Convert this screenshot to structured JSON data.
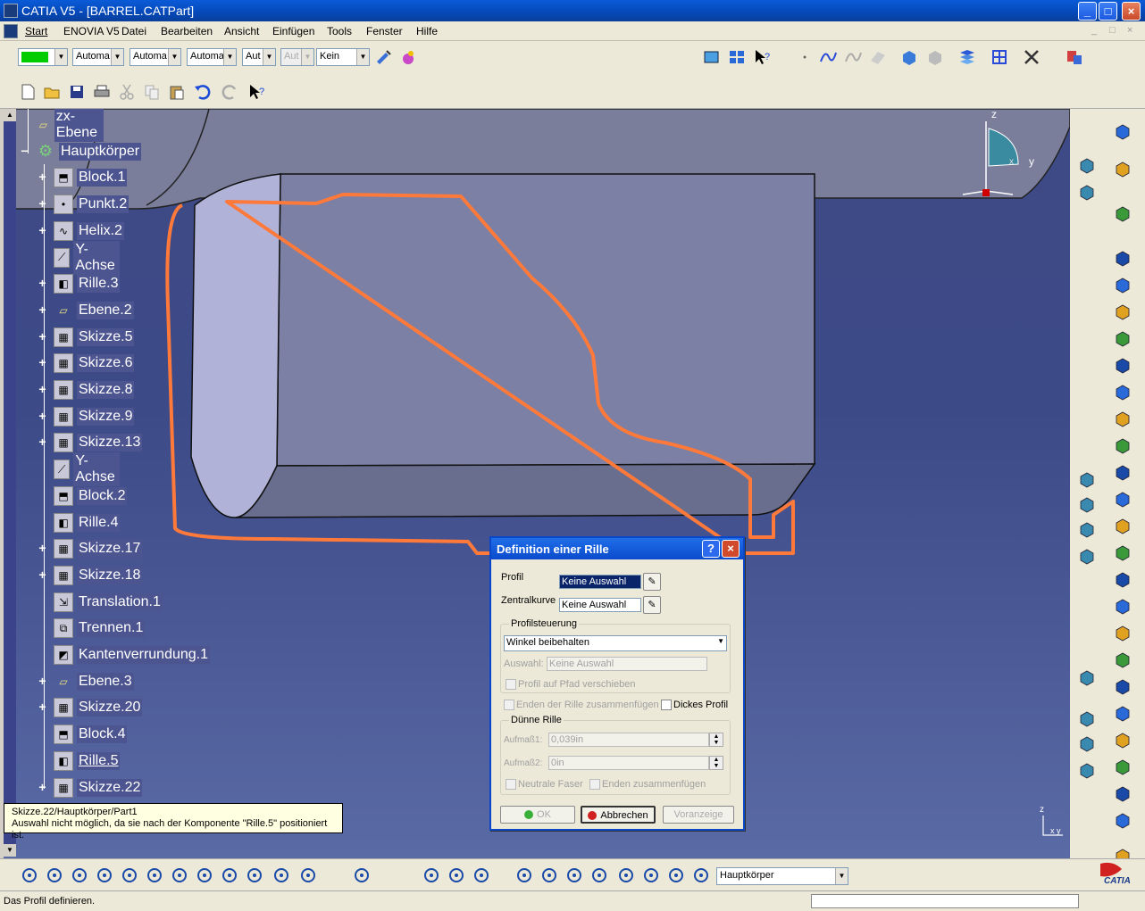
{
  "window": {
    "title": "CATIA V5 - [BARREL.CATPart]"
  },
  "menu": {
    "items": [
      "Start",
      "ENOVIA V5",
      "Datei",
      "Bearbeiten",
      "Ansicht",
      "Einfügen",
      "Tools",
      "Fenster",
      "Hilfe"
    ]
  },
  "toolbar": {
    "color_value": "",
    "combos": [
      "Automa",
      "Automa",
      "Automa",
      "Aut",
      "Aut",
      "Kein"
    ]
  },
  "tree": {
    "nodes": [
      {
        "label": "zx-Ebene",
        "icon": "plane-icon",
        "expandable": false
      },
      {
        "label": "Hauptkörper",
        "icon": "body-icon",
        "expandable": true
      },
      {
        "label": "Block.1",
        "icon": "pad-icon",
        "expandable": true
      },
      {
        "label": "Punkt.2",
        "icon": "point-icon",
        "expandable": true
      },
      {
        "label": "Helix.2",
        "icon": "helix-icon",
        "expandable": true
      },
      {
        "label": "Y-Achse",
        "icon": "axis-icon",
        "expandable": false
      },
      {
        "label": "Rille.3",
        "icon": "groove-icon",
        "expandable": true
      },
      {
        "label": "Ebene.2",
        "icon": "plane-icon",
        "expandable": true
      },
      {
        "label": "Skizze.5",
        "icon": "sketch-icon",
        "expandable": true
      },
      {
        "label": "Skizze.6",
        "icon": "sketch-icon",
        "expandable": true
      },
      {
        "label": "Skizze.8",
        "icon": "sketch-icon",
        "expandable": true
      },
      {
        "label": "Skizze.9",
        "icon": "sketch-icon",
        "expandable": true
      },
      {
        "label": "Skizze.13",
        "icon": "sketch-icon",
        "expandable": true
      },
      {
        "label": "Y-Achse",
        "icon": "axis-icon",
        "expandable": false
      },
      {
        "label": "Block.2",
        "icon": "pad-icon",
        "expandable": false
      },
      {
        "label": "Rille.4",
        "icon": "groove-icon",
        "expandable": false
      },
      {
        "label": "Skizze.17",
        "icon": "sketch-icon",
        "expandable": true
      },
      {
        "label": "Skizze.18",
        "icon": "sketch-icon",
        "expandable": true
      },
      {
        "label": "Translation.1",
        "icon": "translation-icon",
        "expandable": false
      },
      {
        "label": "Trennen.1",
        "icon": "split-icon",
        "expandable": false
      },
      {
        "label": "Kantenverrundung.1",
        "icon": "fillet-icon",
        "expandable": false
      },
      {
        "label": "Ebene.3",
        "icon": "plane-icon",
        "expandable": true
      },
      {
        "label": "Skizze.20",
        "icon": "sketch-icon",
        "expandable": true
      },
      {
        "label": "Block.4",
        "icon": "pad-icon",
        "expandable": false
      },
      {
        "label": "Rille.5",
        "icon": "groove-icon",
        "expandable": false
      },
      {
        "label": "Skizze.22",
        "icon": "sketch-icon",
        "expandable": true
      }
    ]
  },
  "tooltip": {
    "line1": "Skizze.22/Hauptkörper/Part1",
    "line2": "Auswahl nicht möglich, da sie nach der Komponente \"Rille.5\" positioniert ist."
  },
  "compass": {
    "z": "z",
    "y": "y",
    "x": "x"
  },
  "axis_small": {
    "z": "z",
    "xy": "x y"
  },
  "dialog": {
    "title": "Definition einer Rille",
    "help": "?",
    "profil_label": "Profil",
    "profil_value": "Keine Auswahl",
    "zentralkurve_label": "Zentralkurve",
    "zentralkurve_value": "Keine Auswahl",
    "profilsteuerung_label": "Profilsteuerung",
    "profilsteuerung_value": "Winkel beibehalten",
    "auswahl_label": "Auswahl:",
    "auswahl_value": "Keine Auswahl",
    "profil_pfad_label": "Profil auf Pfad verschieben",
    "enden_label": "Enden der Rille zusammenfügen",
    "dickes_label": "Dickes Profil",
    "duenne_label": "Dünne Rille",
    "aufmass1_label": "Aufmaß1:",
    "aufmass1_value": "0,039in",
    "aufmass2_label": "Aufmaß2:",
    "aufmass2_value": "0in",
    "neutrale_label": "Neutrale Faser",
    "enden_zus_label": "Enden zusammenfügen",
    "ok_label": "OK",
    "abbrechen_label": "Abbrechen",
    "vorschau_label": "Voranzeige"
  },
  "bottom": {
    "body_combo": "Hauptkörper"
  },
  "status": {
    "text": "Das Profil definieren."
  },
  "brand": {
    "logo_text": "CATIA"
  },
  "colors": {
    "accent": "#0a5bd8",
    "sketch_orange": "#ff7a3a",
    "viewport": "#3e4a85"
  }
}
